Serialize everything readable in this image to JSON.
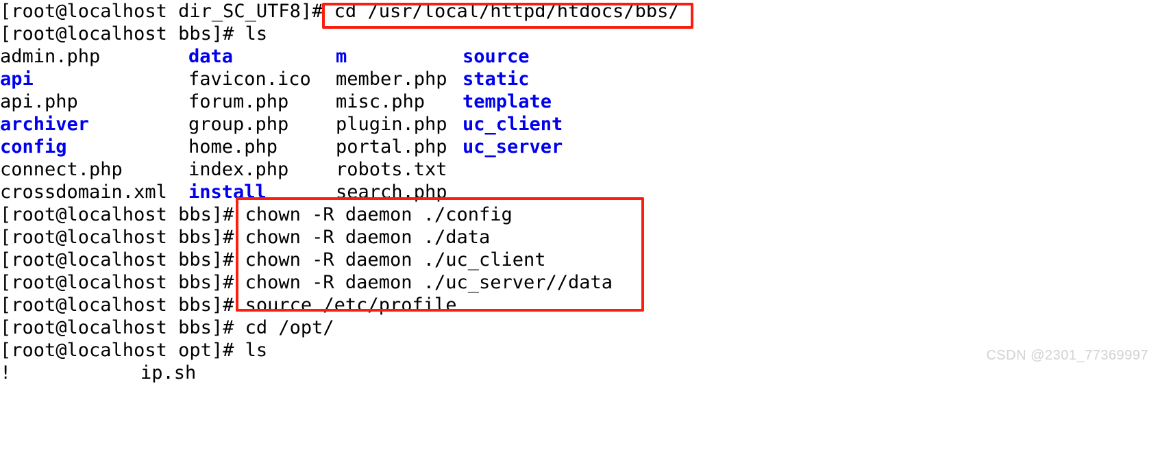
{
  "terminal": {
    "window_title": "root@localhost:/usr/local/httpd/htdocs/bbs",
    "colors": {
      "background": "#ffffff",
      "foreground": "#000000",
      "directory": "#0000ee",
      "highlight_box": "#fa1e0e",
      "watermark": "#d2d2d2"
    },
    "lines": [
      {
        "type": "command",
        "prompt": "[root@localhost dir_SC_UTF8]# ",
        "command": "cd /usr/local/httpd/htdocs/bbs/",
        "highlighted": true
      },
      {
        "type": "command",
        "prompt": "[root@localhost bbs]# ",
        "command": "ls",
        "highlighted": false
      },
      {
        "type": "command",
        "prompt": "[root@localhost bbs]# ",
        "command": "chown -R daemon ./config",
        "highlighted": true
      },
      {
        "type": "command",
        "prompt": "[root@localhost bbs]# ",
        "command": "chown -R daemon ./data",
        "highlighted": true
      },
      {
        "type": "command",
        "prompt": "[root@localhost bbs]# ",
        "command": "chown -R daemon ./uc_client",
        "highlighted": true
      },
      {
        "type": "command",
        "prompt": "[root@localhost bbs]# ",
        "command": "chown -R daemon ./uc_server//data",
        "highlighted": true
      },
      {
        "type": "command",
        "prompt": "[root@localhost bbs]# ",
        "command": "source /etc/profile",
        "highlighted": true
      },
      {
        "type": "command",
        "prompt": "[root@localhost bbs]# ",
        "command": "cd /opt/",
        "highlighted": false
      },
      {
        "type": "command",
        "prompt": "[root@localhost opt]# ",
        "command": "ls",
        "highlighted": false
      }
    ],
    "ls_bbs": {
      "rows": [
        [
          {
            "name": "admin.php",
            "kind": "file"
          },
          {
            "name": "data",
            "kind": "dir"
          },
          {
            "name": "m",
            "kind": "dir"
          },
          {
            "name": "source",
            "kind": "dir"
          }
        ],
        [
          {
            "name": "api",
            "kind": "dir"
          },
          {
            "name": "favicon.ico",
            "kind": "file"
          },
          {
            "name": "member.php",
            "kind": "file"
          },
          {
            "name": "static",
            "kind": "dir"
          }
        ],
        [
          {
            "name": "api.php",
            "kind": "file"
          },
          {
            "name": "forum.php",
            "kind": "file"
          },
          {
            "name": "misc.php",
            "kind": "file"
          },
          {
            "name": "template",
            "kind": "dir"
          }
        ],
        [
          {
            "name": "archiver",
            "kind": "dir"
          },
          {
            "name": "group.php",
            "kind": "file"
          },
          {
            "name": "plugin.php",
            "kind": "file"
          },
          {
            "name": "uc_client",
            "kind": "dir"
          }
        ],
        [
          {
            "name": "config",
            "kind": "dir"
          },
          {
            "name": "home.php",
            "kind": "file"
          },
          {
            "name": "portal.php",
            "kind": "file"
          },
          {
            "name": "uc_server",
            "kind": "dir"
          }
        ],
        [
          {
            "name": "connect.php",
            "kind": "file"
          },
          {
            "name": "index.php",
            "kind": "file"
          },
          {
            "name": "robots.txt",
            "kind": "file"
          },
          {
            "name": "",
            "kind": "file"
          }
        ],
        [
          {
            "name": "crossdomain.xml",
            "kind": "file"
          },
          {
            "name": "install",
            "kind": "dir"
          },
          {
            "name": "search.php",
            "kind": "file"
          },
          {
            "name": "",
            "kind": "file"
          }
        ]
      ]
    },
    "ls_opt": {
      "rows": [
        [
          {
            "name": "!",
            "kind": "file"
          },
          {
            "name": "ip.sh",
            "kind": "file"
          }
        ]
      ]
    }
  },
  "watermark": {
    "text": "CSDN @2301_77369997"
  }
}
